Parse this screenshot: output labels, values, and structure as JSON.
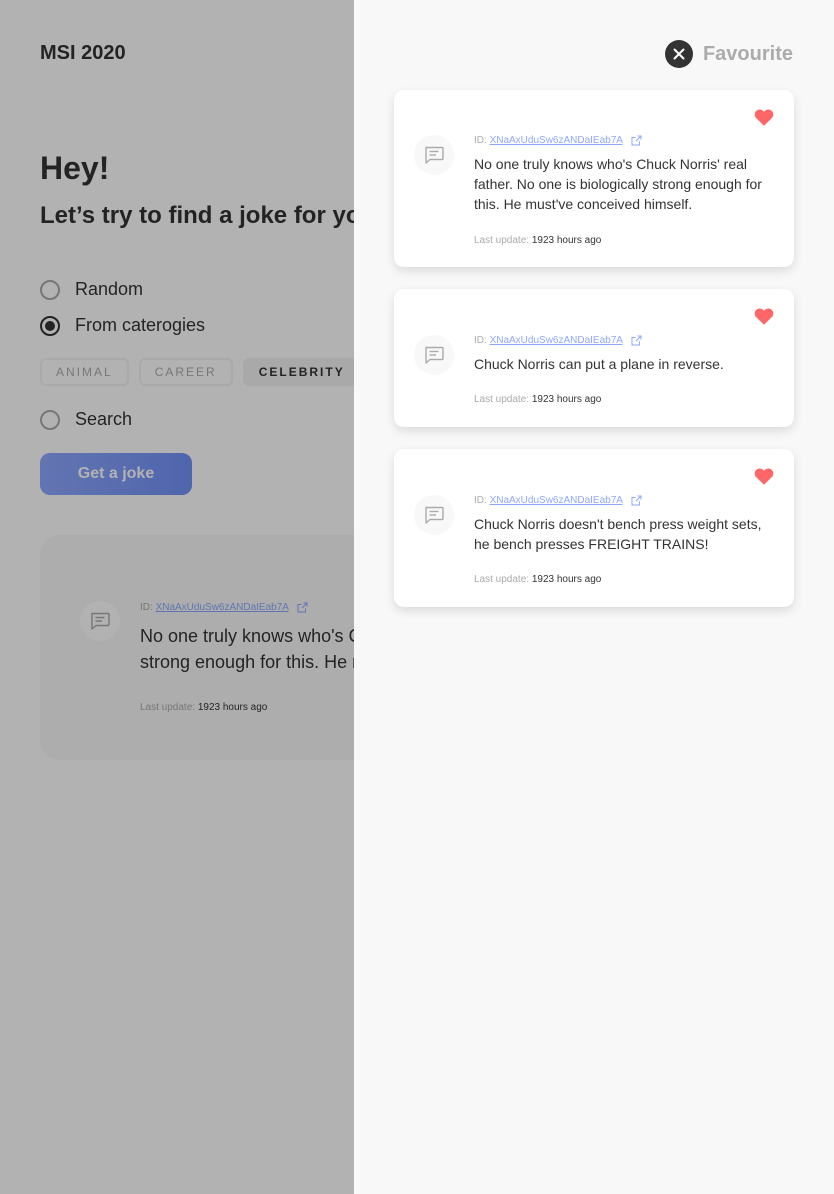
{
  "app": {
    "title": "MSI 2020"
  },
  "hero": {
    "greeting": "Hey!",
    "subtitle": "Let’s try to find a joke for you:"
  },
  "options": {
    "random": "Random",
    "categories": "From caterogies",
    "search": "Search",
    "selected": "From caterogies"
  },
  "categories": [
    "ANIMAL",
    "CAREER",
    "CELEBRITY"
  ],
  "selected_category": "CELEBRITY",
  "get_button": "Get a joke",
  "main_joke": {
    "id_label": "ID:",
    "id": "XNaAxUduSw6zANDaIEab7A",
    "text": "No one truly knows who's Chuck Norris' real father. No one is biologically strong enough for this. He must've conceived himself.",
    "update_label": "Last update:",
    "update_value": "1923 hours ago"
  },
  "favourite": {
    "title": "Favourite",
    "items": [
      {
        "id_label": "ID:",
        "id": "XNaAxUduSw6zANDaIEab7A",
        "text": "No one truly knows who's Chuck Norris' real father. No one is biologically strong enough for this. He must've conceived himself.",
        "update_label": "Last update:",
        "update_value": "1923 hours ago"
      },
      {
        "id_label": "ID:",
        "id": "XNaAxUduSw6zANDaIEab7A",
        "text": "Chuck Norris can put a plane in reverse.",
        "update_label": "Last update:",
        "update_value": "1923 hours ago"
      },
      {
        "id_label": "ID:",
        "id": "XNaAxUduSw6zANDaIEab7A",
        "text": "Chuck Norris doesn't bench press weight sets, he bench presses FREIGHT TRAINS!",
        "update_label": "Last update:",
        "update_value": "1923 hours ago"
      }
    ]
  },
  "colors": {
    "accent": "#8ea7ff",
    "heart": "#ff6767",
    "text": "#333333",
    "muted": "#ababab",
    "panel_bg": "#f8f8f8"
  },
  "icons": {
    "close": "close-icon",
    "heart": "heart-icon",
    "message": "message-icon",
    "external_link": "external-link-icon"
  }
}
